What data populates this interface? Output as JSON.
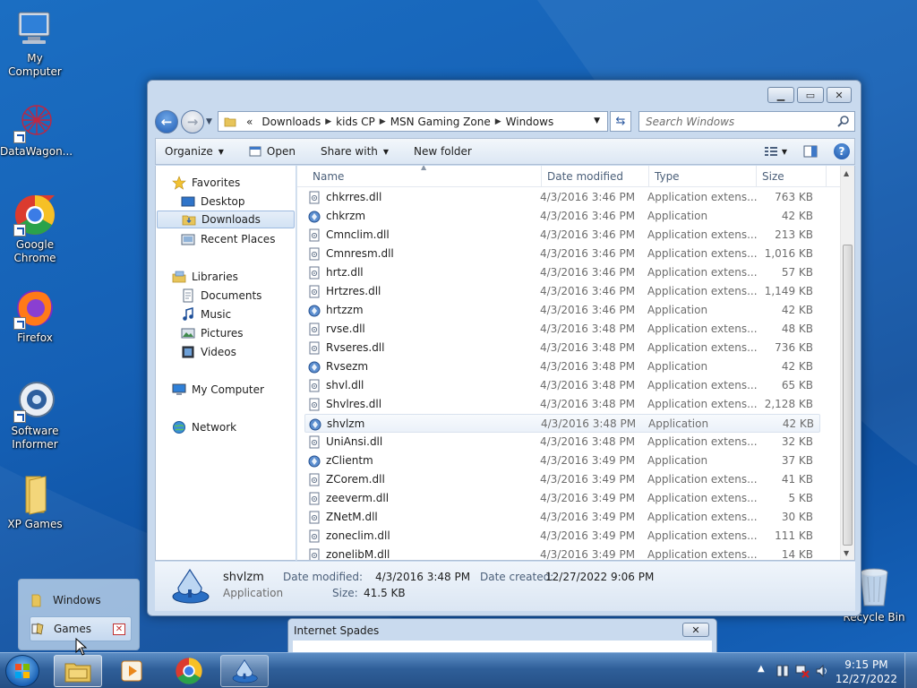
{
  "desktop": {
    "icons": [
      {
        "label": "My Computer"
      },
      {
        "label": "DataWagon..."
      },
      {
        "label": "Google Chrome"
      },
      {
        "label": "Firefox"
      },
      {
        "label": "Software Informer"
      },
      {
        "label": "XP Games"
      },
      {
        "label": "Recycle Bin"
      }
    ]
  },
  "explorer": {
    "breadcrumb": [
      "Downloads",
      "kids CP",
      "MSN Gaming Zone",
      "Windows"
    ],
    "breadcrumb_overflow": "«",
    "search_placeholder": "Search Windows",
    "toolbar": {
      "organize": "Organize",
      "open": "Open",
      "share_with": "Share with",
      "new_folder": "New folder"
    },
    "nav": {
      "favorites": "Favorites",
      "desktop": "Desktop",
      "downloads": "Downloads",
      "recent_places": "Recent Places",
      "libraries": "Libraries",
      "documents": "Documents",
      "music": "Music",
      "pictures": "Pictures",
      "videos": "Videos",
      "my_computer": "My Computer",
      "network": "Network"
    },
    "columns": {
      "name": "Name",
      "date": "Date modified",
      "type": "Type",
      "size": "Size"
    },
    "files": [
      {
        "name": "chkrres.dll",
        "date": "4/3/2016 3:46 PM",
        "type": "Application extens...",
        "size": "763 KB"
      },
      {
        "name": "chkrzm",
        "date": "4/3/2016 3:46 PM",
        "type": "Application",
        "size": "42 KB"
      },
      {
        "name": "Cmnclim.dll",
        "date": "4/3/2016 3:46 PM",
        "type": "Application extens...",
        "size": "213 KB"
      },
      {
        "name": "Cmnresm.dll",
        "date": "4/3/2016 3:46 PM",
        "type": "Application extens...",
        "size": "1,016 KB"
      },
      {
        "name": "hrtz.dll",
        "date": "4/3/2016 3:46 PM",
        "type": "Application extens...",
        "size": "57 KB"
      },
      {
        "name": "Hrtzres.dll",
        "date": "4/3/2016 3:46 PM",
        "type": "Application extens...",
        "size": "1,149 KB"
      },
      {
        "name": "hrtzzm",
        "date": "4/3/2016 3:46 PM",
        "type": "Application",
        "size": "42 KB"
      },
      {
        "name": "rvse.dll",
        "date": "4/3/2016 3:48 PM",
        "type": "Application extens...",
        "size": "48 KB"
      },
      {
        "name": "Rvseres.dll",
        "date": "4/3/2016 3:48 PM",
        "type": "Application extens...",
        "size": "736 KB"
      },
      {
        "name": "Rvsezm",
        "date": "4/3/2016 3:48 PM",
        "type": "Application",
        "size": "42 KB"
      },
      {
        "name": "shvl.dll",
        "date": "4/3/2016 3:48 PM",
        "type": "Application extens...",
        "size": "65 KB"
      },
      {
        "name": "Shvlres.dll",
        "date": "4/3/2016 3:48 PM",
        "type": "Application extens...",
        "size": "2,128 KB"
      },
      {
        "name": "shvlzm",
        "date": "4/3/2016 3:48 PM",
        "type": "Application",
        "size": "42 KB"
      },
      {
        "name": "UniAnsi.dll",
        "date": "4/3/2016 3:48 PM",
        "type": "Application extens...",
        "size": "32 KB"
      },
      {
        "name": "zClientm",
        "date": "4/3/2016 3:49 PM",
        "type": "Application",
        "size": "37 KB"
      },
      {
        "name": "ZCorem.dll",
        "date": "4/3/2016 3:49 PM",
        "type": "Application extens...",
        "size": "41 KB"
      },
      {
        "name": "zeeverm.dll",
        "date": "4/3/2016 3:49 PM",
        "type": "Application extens...",
        "size": "5 KB"
      },
      {
        "name": "ZNetM.dll",
        "date": "4/3/2016 3:49 PM",
        "type": "Application extens...",
        "size": "30 KB"
      },
      {
        "name": "zoneclim.dll",
        "date": "4/3/2016 3:49 PM",
        "type": "Application extens...",
        "size": "111 KB"
      },
      {
        "name": "zonelibM.dll",
        "date": "4/3/2016 3:49 PM",
        "type": "Application extens...",
        "size": "14 KB"
      }
    ],
    "details": {
      "name": "shvlzm",
      "kind": "Application",
      "date_modified_label": "Date modified:",
      "date_modified": "4/3/2016 3:48 PM",
      "date_created_label": "Date created:",
      "date_created": "12/27/2022 9:06 PM",
      "size_label": "Size:",
      "size": "41.5 KB"
    }
  },
  "spades_window": {
    "title": "Internet Spades"
  },
  "jumplist": {
    "items": [
      "Windows",
      "Games"
    ]
  },
  "taskbar": {
    "time": "9:15 PM",
    "date": "12/27/2022"
  },
  "colors": {
    "accent": "#1f5cb4",
    "selection": "#d2e2f4"
  }
}
